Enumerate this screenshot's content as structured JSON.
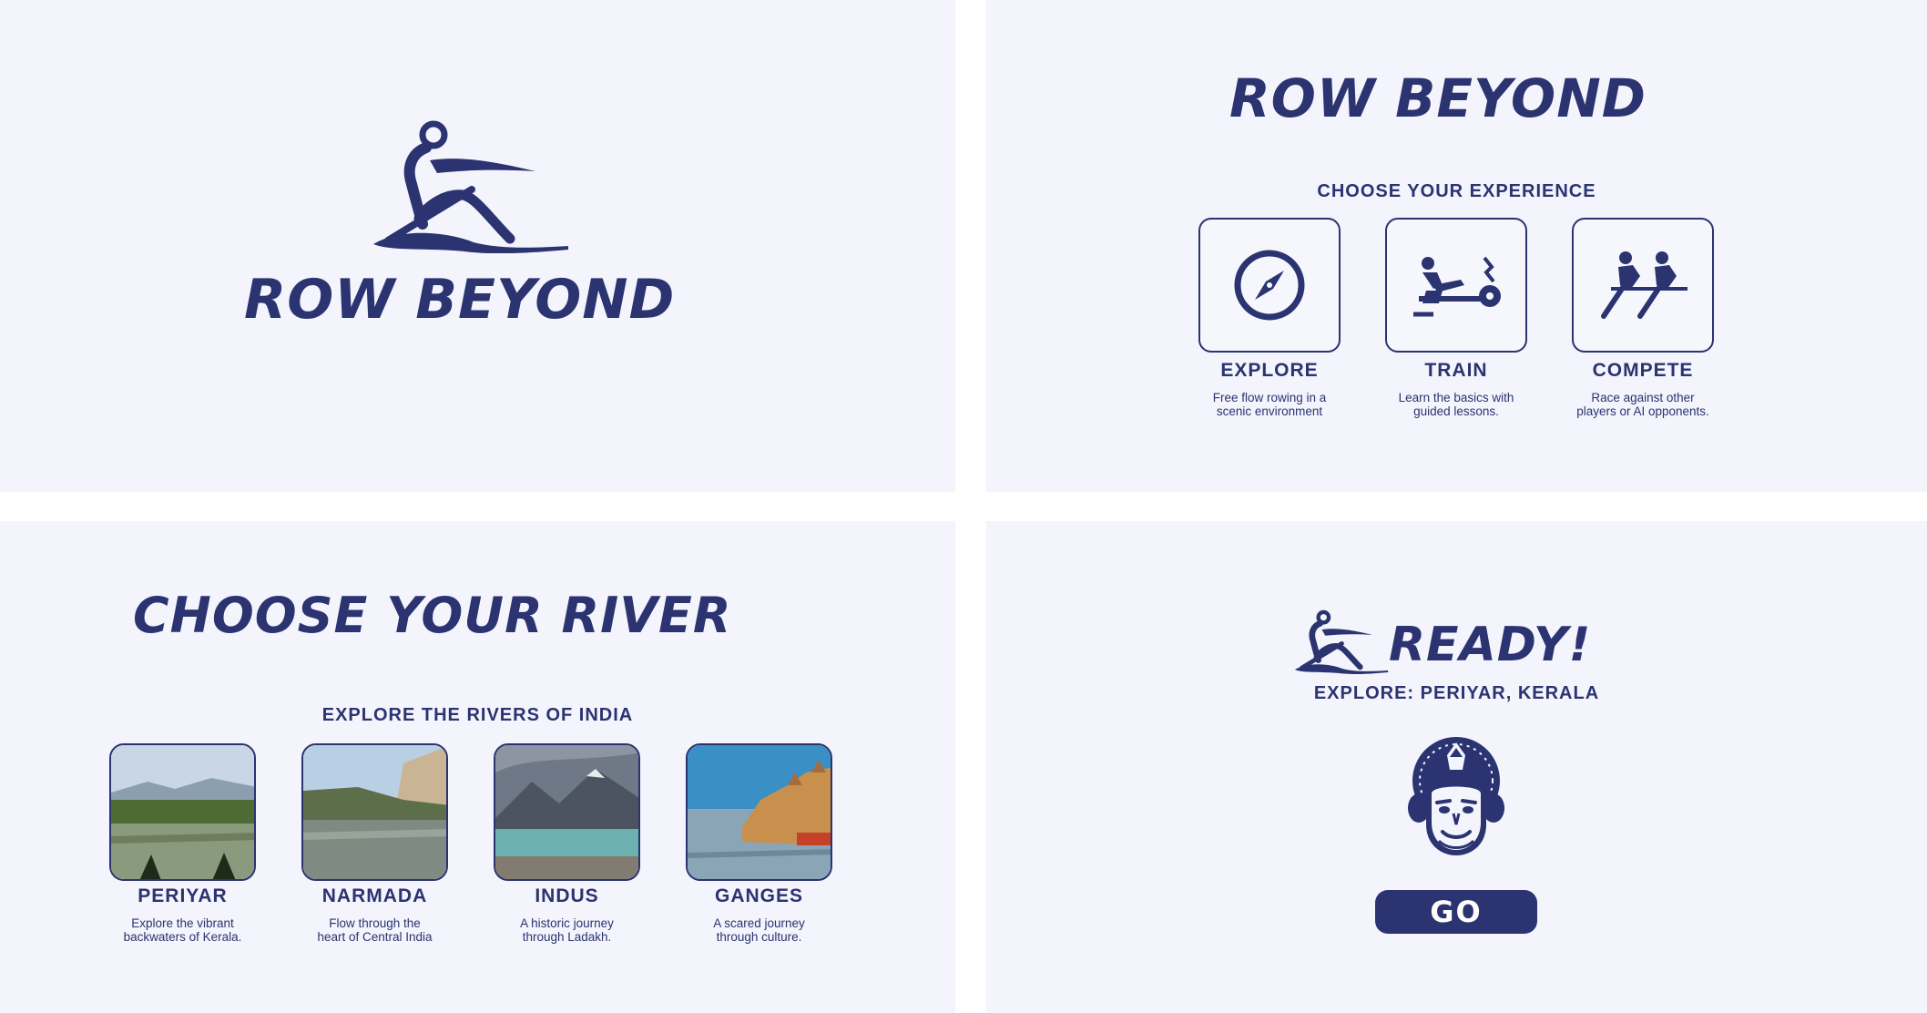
{
  "colors": {
    "primary": "#2b3370",
    "panel_bg": "#f3f4fc",
    "gutter": "#ffffff"
  },
  "splash": {
    "brand": "ROW BEYOND",
    "logo_icon": "rower-logo-icon"
  },
  "mode_select": {
    "brand": "ROW BEYOND",
    "heading": "CHOOSE YOUR EXPERIENCE",
    "options": [
      {
        "title": "EXPLORE",
        "desc_line1": "Free flow rowing in a",
        "desc_line2": "scenic environment",
        "icon": "compass-icon"
      },
      {
        "title": "TRAIN",
        "desc_line1": "Learn the basics with",
        "desc_line2": "guided lessons.",
        "icon": "rowing-machine-icon"
      },
      {
        "title": "COMPETE",
        "desc_line1": "Race against other",
        "desc_line2": "players or AI opponents.",
        "icon": "two-rowers-icon"
      }
    ]
  },
  "river_select": {
    "title": "CHOOSE YOUR RIVER",
    "heading": "EXPLORE THE RIVERS OF INDIA",
    "rivers": [
      {
        "name": "PERIYAR",
        "desc_line1": "Explore the vibrant",
        "desc_line2": "backwaters of Kerala."
      },
      {
        "name": "NARMADA",
        "desc_line1": "Flow through the",
        "desc_line2": "heart of Central  India"
      },
      {
        "name": "INDUS",
        "desc_line1": "A historic journey",
        "desc_line2": "through Ladakh."
      },
      {
        "name": "GANGES",
        "desc_line1": "A scared journey",
        "desc_line2": "through culture."
      }
    ]
  },
  "ready": {
    "title": "READY!",
    "selection": "EXPLORE: PERIYAR, KERALA",
    "emblem_icon": "kathakali-mask-icon",
    "go_label": "GO"
  }
}
